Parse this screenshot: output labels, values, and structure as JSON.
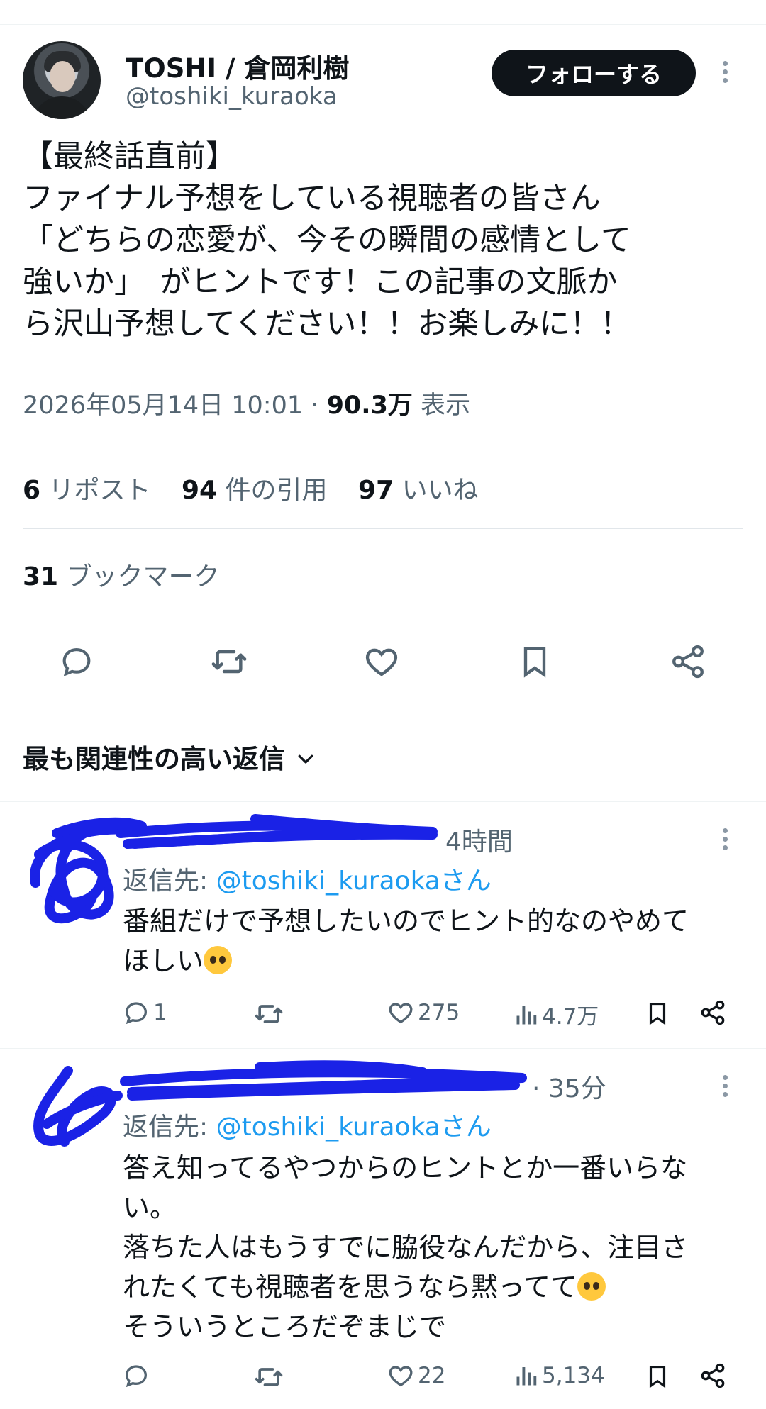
{
  "tweet": {
    "display_name": "TOSHI / 倉岡利樹",
    "handle": "@toshiki_kuraoka",
    "follow_label": "フォローする",
    "text": "【最終話直前】\nファイナル予想をしている視聴者の皆さん\n「どちらの恋愛が、今その瞬間の感情として\n強いか」　がヒントです！この記事の文脈か\nら沢山予想してください！！お楽しみに！！",
    "timestamp": "2026年05月14日 10:01",
    "separator": "·",
    "views_count": "90.3万",
    "views_label": "表示"
  },
  "stats": {
    "reposts_count": "6",
    "reposts_label": "リポスト",
    "quotes_count": "94",
    "quotes_label": "件の引用",
    "likes_count": "97",
    "likes_label": "いいね",
    "bookmarks_count": "31",
    "bookmarks_label": "ブックマーク"
  },
  "actions": [
    "reply-icon",
    "repost-icon",
    "like-icon",
    "bookmark-icon",
    "share-icon"
  ],
  "replies_section": {
    "title": "最も関連性の高い返信"
  },
  "replies": [
    {
      "time": "4時間",
      "reply_to_prefix": "返信先: ",
      "reply_to_handle": "@toshiki_kuraokaさん",
      "text": "番組だけで予想したいのでヒント的なのやめて\nほしい",
      "reply_count": "1",
      "like_count": "275",
      "view_count": "4.7万"
    },
    {
      "time": "· 35分",
      "reply_to_prefix": "返信先: ",
      "reply_to_handle": "@toshiki_kuraokaさん",
      "text_lines": [
        "答え知ってるやつからのヒントとか一番いらな",
        "い。",
        "落ちた人はもうすでに脇役なんだから、注目さ",
        "れたくても視聴者を思うなら黙ってて",
        "そういうところだぞまじで"
      ],
      "reply_count": "",
      "like_count": "22",
      "view_count": "5,134"
    }
  ],
  "colors": {
    "accent": "#1d9bf0",
    "text": "#0f1419",
    "muted": "#536471",
    "scribble": "#1a22e6"
  }
}
